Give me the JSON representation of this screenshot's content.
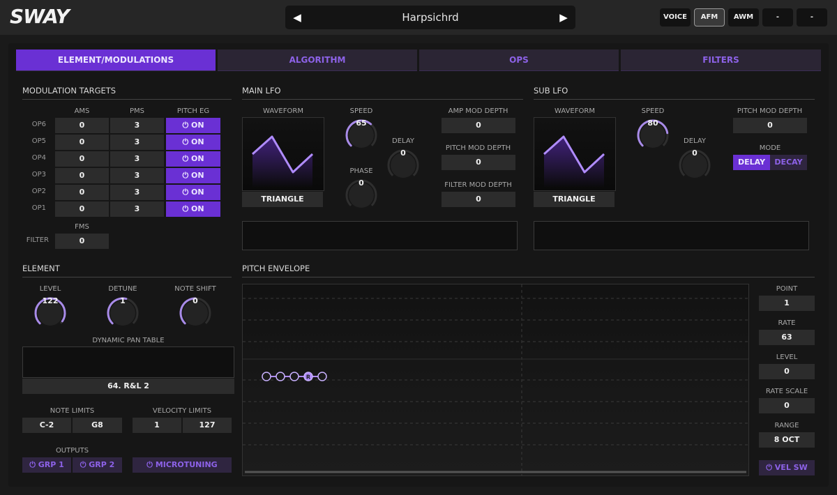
{
  "app": {
    "logo": "SWAY"
  },
  "preset": {
    "prev": "◀",
    "name": "Harpsichrd",
    "next": "▶"
  },
  "modes": [
    "VOICE",
    "AFM",
    "AWM",
    "-",
    "-"
  ],
  "tabs": [
    "ELEMENT/MODULATIONS",
    "ALGORITHM",
    "OPS",
    "FILTERS"
  ],
  "mod_targets": {
    "title": "MODULATION TARGETS",
    "headers": [
      "AMS",
      "PMS",
      "PITCH EG"
    ],
    "rows": [
      {
        "op": "OP6",
        "ams": "0",
        "pms": "3",
        "peg": "ON"
      },
      {
        "op": "OP5",
        "ams": "0",
        "pms": "3",
        "peg": "ON"
      },
      {
        "op": "OP4",
        "ams": "0",
        "pms": "3",
        "peg": "ON"
      },
      {
        "op": "OP3",
        "ams": "0",
        "pms": "3",
        "peg": "ON"
      },
      {
        "op": "OP2",
        "ams": "0",
        "pms": "3",
        "peg": "ON"
      },
      {
        "op": "OP1",
        "ams": "0",
        "pms": "3",
        "peg": "ON"
      }
    ],
    "fms_label": "FMS",
    "filter_label": "FILTER",
    "filter_value": "0"
  },
  "main_lfo": {
    "title": "MAIN LFO",
    "waveform_label": "WAVEFORM",
    "waveform": "TRIANGLE",
    "speed_label": "SPEED",
    "speed": "65",
    "phase_label": "PHASE",
    "phase": "0",
    "delay_label": "DELAY",
    "delay": "0",
    "amp_label": "AMP MOD DEPTH",
    "amp": "0",
    "pitch_label": "PITCH MOD DEPTH",
    "pitch": "0",
    "filter_label": "FILTER MOD DEPTH",
    "filter": "0"
  },
  "sub_lfo": {
    "title": "SUB LFO",
    "waveform_label": "WAVEFORM",
    "waveform": "TRIANGLE",
    "speed_label": "SPEED",
    "speed": "80",
    "delay_label": "DELAY",
    "delay": "0",
    "pitch_label": "PITCH MOD DEPTH",
    "pitch": "0",
    "mode_label": "MODE",
    "mode_delay": "DELAY",
    "mode_decay": "DECAY"
  },
  "element": {
    "title": "ELEMENT",
    "level_label": "LEVEL",
    "level": "122",
    "detune_label": "DETUNE",
    "detune": "1",
    "shift_label": "NOTE SHIFT",
    "shift": "0",
    "pan_label": "DYNAMIC PAN TABLE",
    "pan": "64. R&L 2",
    "note_limits_label": "NOTE LIMITS",
    "note_lo": "C-2",
    "note_hi": "G8",
    "vel_limits_label": "VELOCITY LIMITS",
    "vel_lo": "1",
    "vel_hi": "127",
    "outputs_label": "OUTPUTS",
    "grp1": "GRP 1",
    "grp2": "GRP 2",
    "microtuning": "MICROTUNING"
  },
  "pitch_env": {
    "title": "PITCH ENVELOPE",
    "release_marker": "R",
    "point_label": "POINT",
    "point": "1",
    "rate_label": "RATE",
    "rate": "63",
    "level_label": "LEVEL",
    "level": "0",
    "rate_scale_label": "RATE SCALE",
    "rate_scale": "0",
    "range_label": "RANGE",
    "range": "8 OCT",
    "vel_sw": "VEL SW"
  },
  "knob_levels": {
    "lfo_speed": 0.65,
    "lfo_phase": 0,
    "lfo_delay": 0,
    "sub_speed": 0.8,
    "sub_delay": 0,
    "level": 0.96,
    "detune": 0.55,
    "shift": 0.5
  },
  "colors": {
    "accent": "#6a30d4",
    "accent_text": "#8d62e8",
    "knob_arc": "#a88be8"
  }
}
